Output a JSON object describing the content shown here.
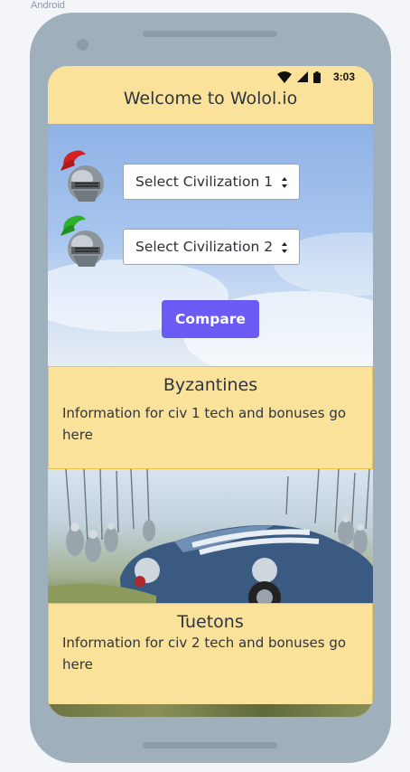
{
  "frame_label": "Android",
  "status_bar": {
    "time": "3:03"
  },
  "app": {
    "title": "Welcome to Wolol.io"
  },
  "selectors": {
    "civ1": {
      "selected": "Select Civilization 1",
      "helmet": "red-plumed-helmet-icon"
    },
    "civ2": {
      "selected": "Select Civilization 2",
      "helmet": "green-plumed-helmet-icon"
    }
  },
  "compare_button": {
    "label": "Compare"
  },
  "civ1_card": {
    "name": "Byzantines",
    "info": "Information for civ 1 tech and bonuses go here"
  },
  "civ2_card": {
    "name": "Tuetons",
    "info": "Information for civ 2 tech and bonuses go here"
  },
  "colors": {
    "accent": "#6a5bf5",
    "card_bg": "#fbe29a",
    "card_border": "#f0c24c",
    "phone": "#a0afbc"
  }
}
